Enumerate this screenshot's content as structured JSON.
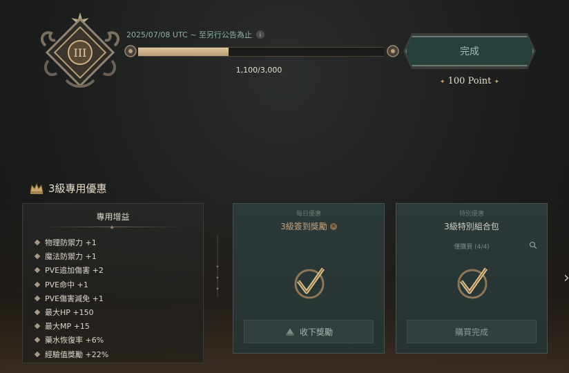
{
  "header": {
    "rank_numeral": "III",
    "date_text": "2025/07/08 UTC ~ 至另行公告為止",
    "info_icon": "i",
    "progress_text": "1,100/3,000",
    "progress_fraction": 0.367,
    "complete_button": "完成",
    "points_text": "100 Point",
    "point_star": "✦"
  },
  "section": {
    "title": "3級專用優惠"
  },
  "perks": {
    "heading": "專用增益",
    "items": [
      "物理防禦力 +1",
      "魔法防禦力 +1",
      "PVE追加傷害 +2",
      "PVE命中 +1",
      "PVE傷害減免 +1",
      "最大HP +150",
      "最大MP +15",
      "藥水恢復率 +6%",
      "經驗值獎勵 +22%"
    ]
  },
  "cards": [
    {
      "label": "每日優惠",
      "title": "3級簽到獎勵",
      "button": "收下獎勵"
    },
    {
      "label": "特別優惠",
      "title": "3級特別組合包",
      "subtitle": "僅購買 (4/4)",
      "button": "購買完成"
    }
  ],
  "colors": {
    "accent_gold": "#c9a66b",
    "teal_button": "#27403c"
  }
}
